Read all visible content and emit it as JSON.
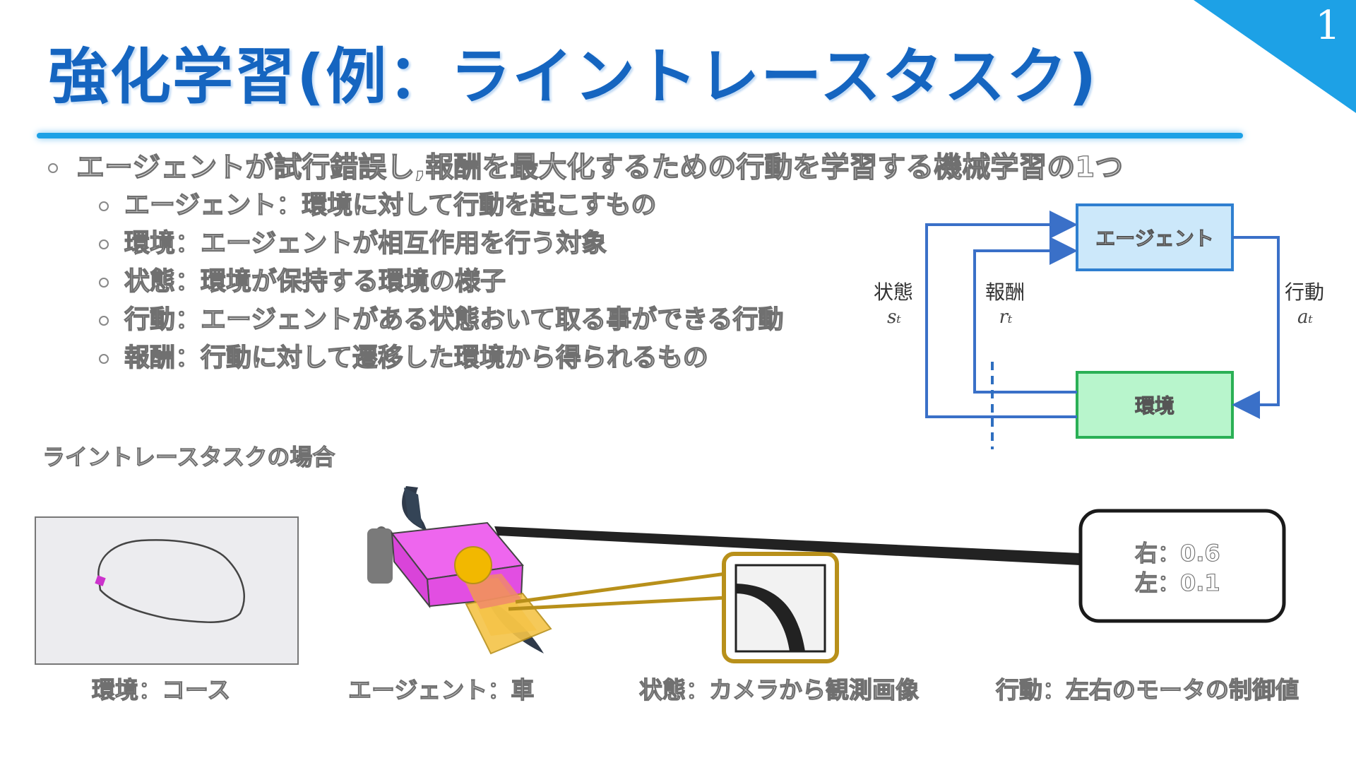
{
  "page_number": "1",
  "title": "強化学習(例：ライントレースタスク)",
  "bullets": {
    "main": "エージェントが試行錯誤し,報酬を最大化するための行動を学習する機械学習の1つ",
    "items": [
      "エージェント：環境に対して行動を起こすもの",
      "環境：エージェントが相互作用を行う対象",
      "状態：環境が保持する環境の様子",
      "行動：エージェントがある状態おいて取る事ができる行動",
      "報酬：行動に対して遷移した環境から得られるもの"
    ]
  },
  "diagram": {
    "agent_label": "エージェント",
    "env_label": "環境",
    "state_label": "状態",
    "state_symbol": "sₜ",
    "reward_label": "報酬",
    "reward_symbol": "rₜ",
    "action_label": "行動",
    "action_symbol": "aₜ",
    "agent_color": "#cce8fa",
    "env_color": "#b8f5cc"
  },
  "subheading": "ライントレースタスクの場合",
  "captions": {
    "environment": "環境：コース",
    "agent": "エージェント：車",
    "state": "状態：カメラから観測画像",
    "action": "行動：左右のモータの制御値"
  },
  "callout": {
    "right": "右：0.6",
    "left": "左：0.1"
  },
  "colors": {
    "title": "#1565c0",
    "accent": "#1da1e6",
    "car_body": "#ee66ee",
    "camera_frame": "#b8901a"
  }
}
